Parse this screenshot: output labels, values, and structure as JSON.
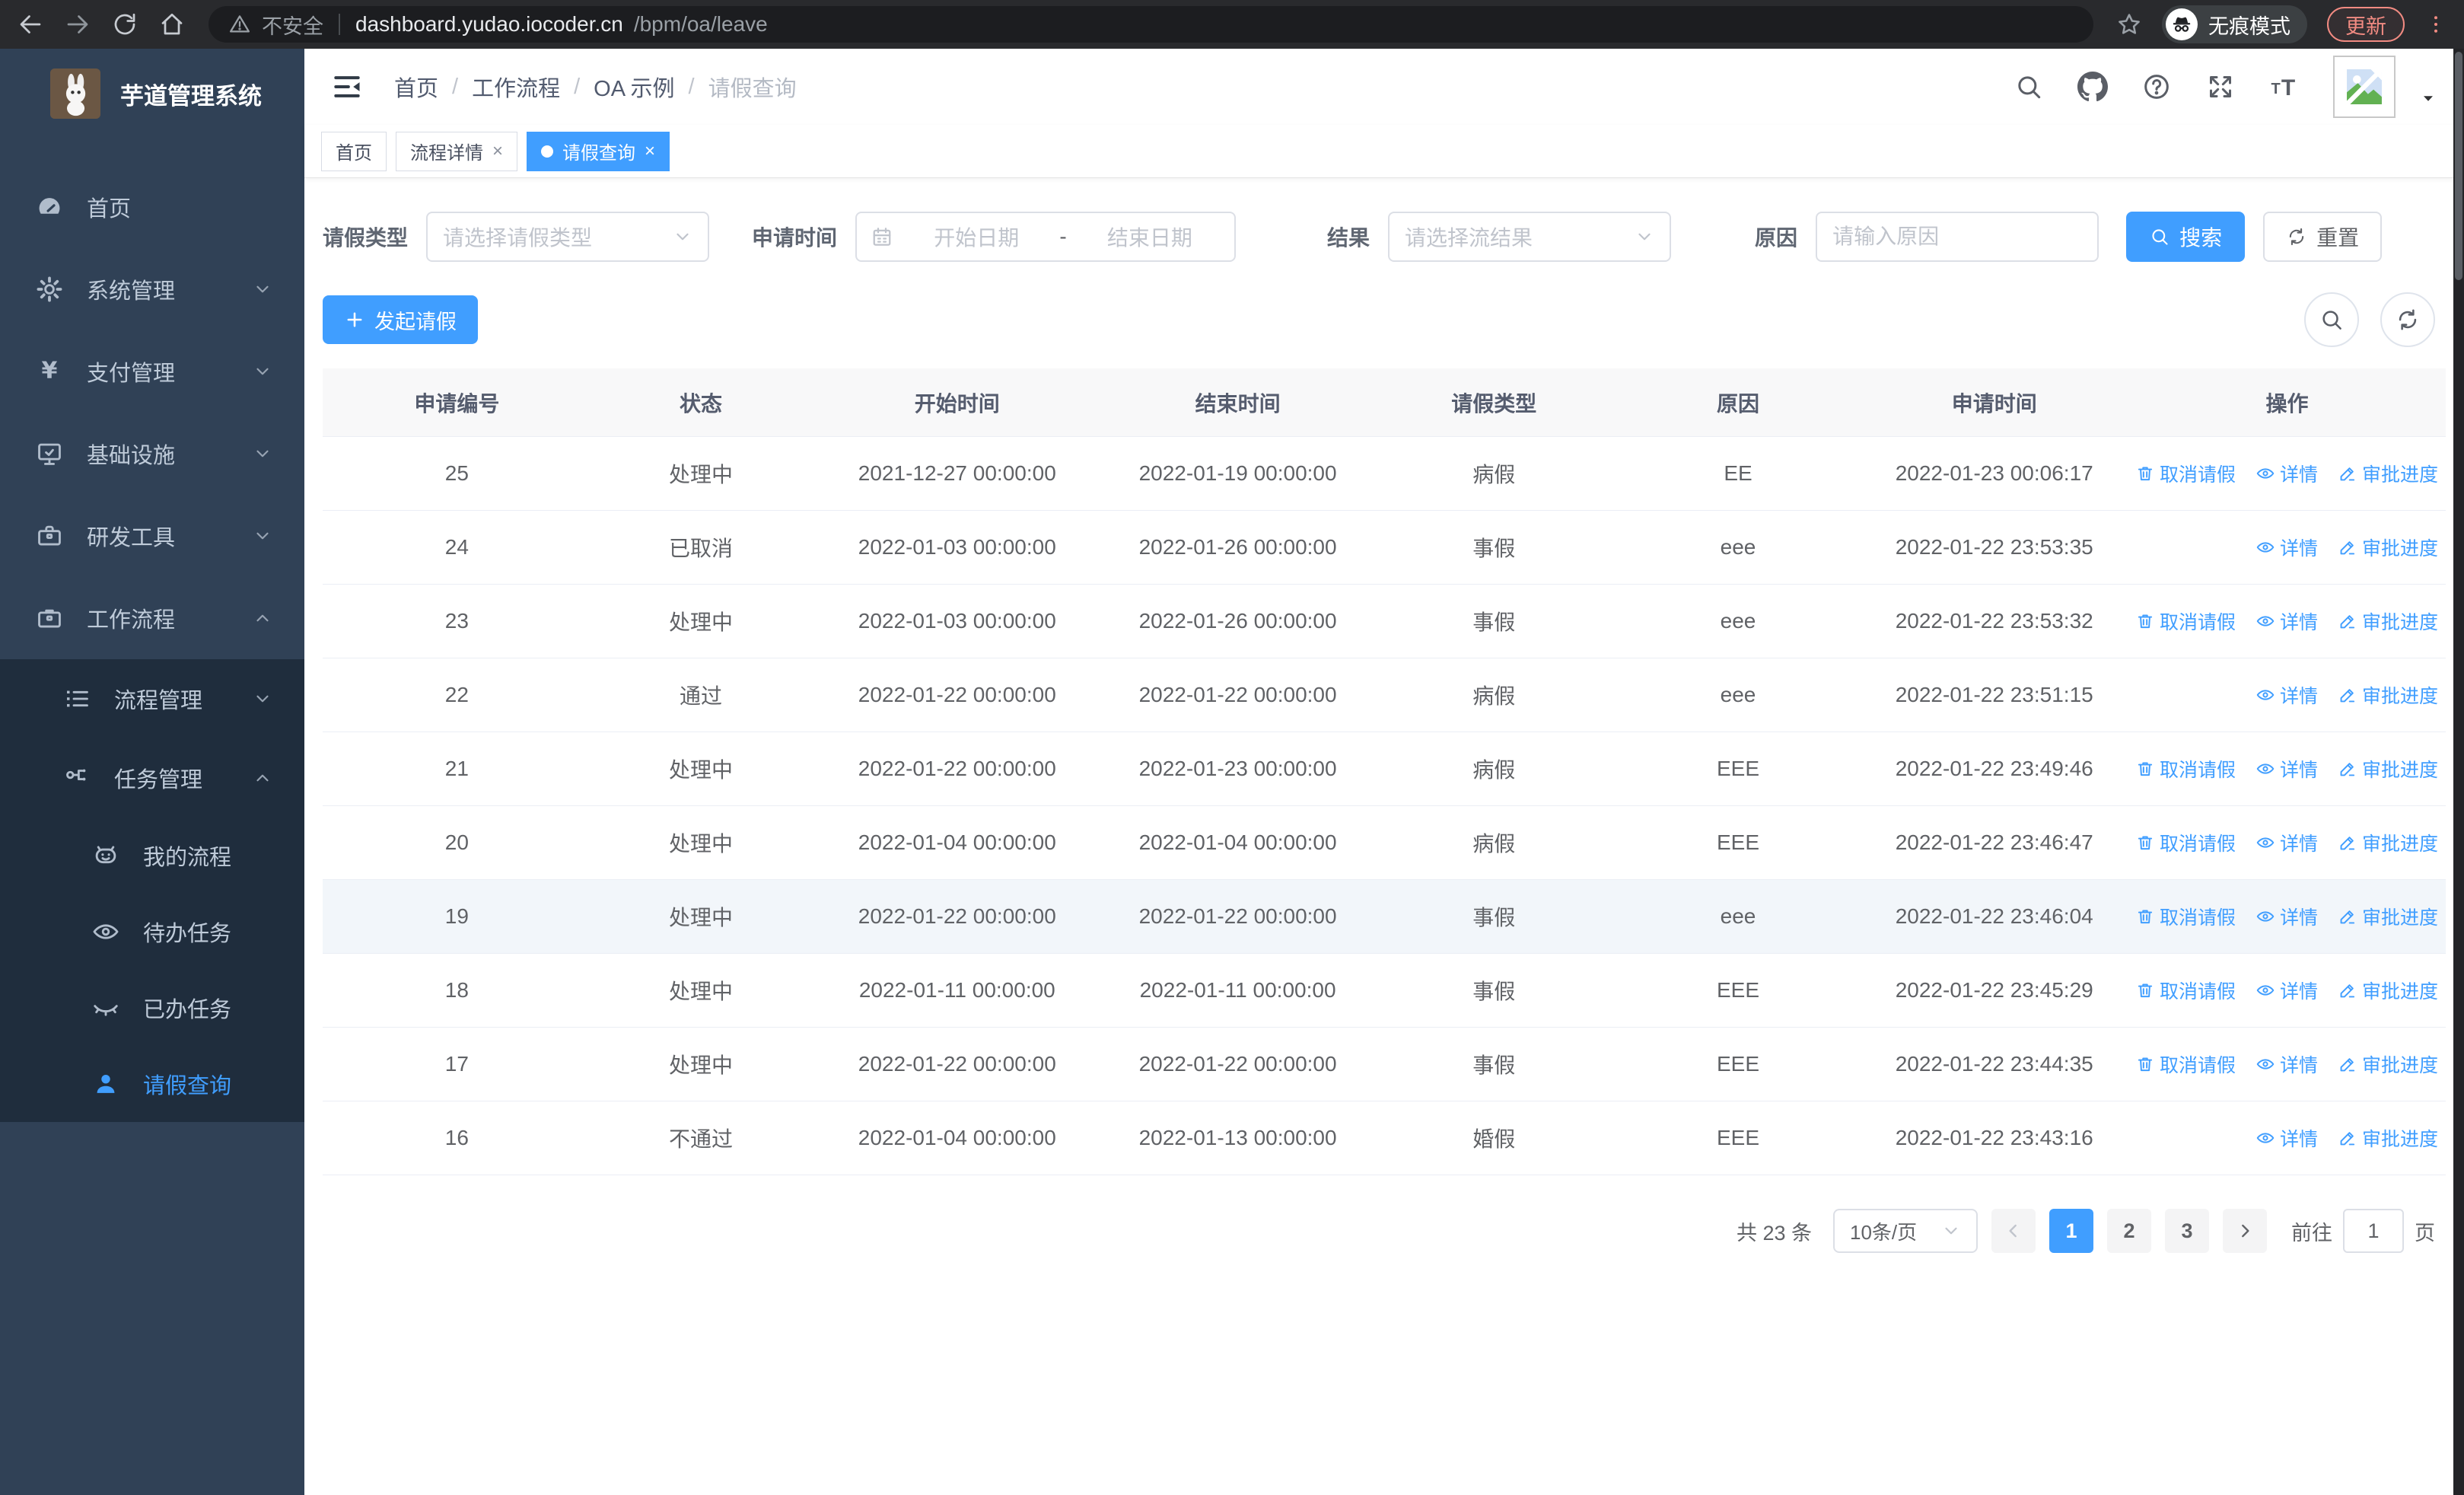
{
  "browser": {
    "security_label": "不安全",
    "url_host": "dashboard.yudao.iocoder.cn",
    "url_path": "/bpm/oa/leave",
    "incognito_label": "无痕模式",
    "update_label": "更新"
  },
  "sidebar": {
    "app_title": "芋道管理系统",
    "menu": [
      {
        "name": "home",
        "label": "首页",
        "icon": "dashboard-icon",
        "level": 1,
        "chevron": null,
        "submenu": false,
        "active": false
      },
      {
        "name": "system-management",
        "label": "系统管理",
        "icon": "gear-icon",
        "level": 1,
        "chevron": "down",
        "submenu": false,
        "active": false
      },
      {
        "name": "payment-management",
        "label": "支付管理",
        "icon": "yen-icon",
        "level": 1,
        "chevron": "down",
        "submenu": false,
        "active": false
      },
      {
        "name": "infrastructure",
        "label": "基础设施",
        "icon": "monitor-icon",
        "level": 1,
        "chevron": "down",
        "submenu": false,
        "active": false
      },
      {
        "name": "dev-tools",
        "label": "研发工具",
        "icon": "toolbox-icon",
        "level": 1,
        "chevron": "down",
        "submenu": false,
        "active": false
      },
      {
        "name": "workflow",
        "label": "工作流程",
        "icon": "briefcase-icon",
        "level": 1,
        "chevron": "up",
        "submenu": false,
        "active": false
      },
      {
        "name": "process-management",
        "label": "流程管理",
        "icon": "list-icon",
        "level": 2,
        "chevron": "down",
        "submenu": true,
        "active": false
      },
      {
        "name": "task-management",
        "label": "任务管理",
        "icon": "flow-icon",
        "level": 2,
        "chevron": "up",
        "submenu": true,
        "active": false
      },
      {
        "name": "my-process",
        "label": "我的流程",
        "icon": "robot-icon",
        "level": 3,
        "chevron": null,
        "submenu": true,
        "active": false
      },
      {
        "name": "todo-tasks",
        "label": "待办任务",
        "icon": "eye-icon",
        "level": 3,
        "chevron": null,
        "submenu": true,
        "active": false
      },
      {
        "name": "done-tasks",
        "label": "已办任务",
        "icon": "eye-closed-icon",
        "level": 3,
        "chevron": null,
        "submenu": true,
        "active": false
      },
      {
        "name": "leave-query",
        "label": "请假查询",
        "icon": "user-icon",
        "level": 3,
        "chevron": null,
        "submenu": true,
        "active": true
      }
    ]
  },
  "navbar": {
    "breadcrumb": [
      "首页",
      "工作流程",
      "OA 示例",
      "请假查询"
    ]
  },
  "tags": [
    {
      "label": "首页",
      "closable": false,
      "active": false
    },
    {
      "label": "流程详情",
      "closable": true,
      "active": false
    },
    {
      "label": "请假查询",
      "closable": true,
      "active": true
    }
  ],
  "filters": {
    "type_label": "请假类型",
    "type_placeholder": "请选择请假类型",
    "time_label": "申请时间",
    "time_start_placeholder": "开始日期",
    "time_separator": "-",
    "time_end_placeholder": "结束日期",
    "result_label": "结果",
    "result_placeholder": "请选择流结果",
    "reason_label": "原因",
    "reason_placeholder": "请输入原因",
    "search_label": "搜索",
    "reset_label": "重置"
  },
  "toolbar": {
    "create_label": "发起请假"
  },
  "table": {
    "columns": [
      "申请编号",
      "状态",
      "开始时间",
      "结束时间",
      "请假类型",
      "原因",
      "申请时间",
      "操作"
    ],
    "action_labels": {
      "cancel": "取消请假",
      "detail": "详情",
      "progress": "审批进度"
    },
    "rows": [
      {
        "id": "25",
        "status": "处理中",
        "start": "2021-12-27 00:00:00",
        "end": "2022-01-19 00:00:00",
        "type": "病假",
        "reason": "EE",
        "apply_time": "2022-01-23 00:06:17",
        "actions": [
          "cancel",
          "detail",
          "progress"
        ],
        "highlight": false
      },
      {
        "id": "24",
        "status": "已取消",
        "start": "2022-01-03 00:00:00",
        "end": "2022-01-26 00:00:00",
        "type": "事假",
        "reason": "eee",
        "apply_time": "2022-01-22 23:53:35",
        "actions": [
          "detail",
          "progress"
        ],
        "highlight": false
      },
      {
        "id": "23",
        "status": "处理中",
        "start": "2022-01-03 00:00:00",
        "end": "2022-01-26 00:00:00",
        "type": "事假",
        "reason": "eee",
        "apply_time": "2022-01-22 23:53:32",
        "actions": [
          "cancel",
          "detail",
          "progress"
        ],
        "highlight": false
      },
      {
        "id": "22",
        "status": "通过",
        "start": "2022-01-22 00:00:00",
        "end": "2022-01-22 00:00:00",
        "type": "病假",
        "reason": "eee",
        "apply_time": "2022-01-22 23:51:15",
        "actions": [
          "detail",
          "progress"
        ],
        "highlight": false
      },
      {
        "id": "21",
        "status": "处理中",
        "start": "2022-01-22 00:00:00",
        "end": "2022-01-23 00:00:00",
        "type": "病假",
        "reason": "EEE",
        "apply_time": "2022-01-22 23:49:46",
        "actions": [
          "cancel",
          "detail",
          "progress"
        ],
        "highlight": false
      },
      {
        "id": "20",
        "status": "处理中",
        "start": "2022-01-04 00:00:00",
        "end": "2022-01-04 00:00:00",
        "type": "病假",
        "reason": "EEE",
        "apply_time": "2022-01-22 23:46:47",
        "actions": [
          "cancel",
          "detail",
          "progress"
        ],
        "highlight": false
      },
      {
        "id": "19",
        "status": "处理中",
        "start": "2022-01-22 00:00:00",
        "end": "2022-01-22 00:00:00",
        "type": "事假",
        "reason": "eee",
        "apply_time": "2022-01-22 23:46:04",
        "actions": [
          "cancel",
          "detail",
          "progress"
        ],
        "highlight": true
      },
      {
        "id": "18",
        "status": "处理中",
        "start": "2022-01-11 00:00:00",
        "end": "2022-01-11 00:00:00",
        "type": "事假",
        "reason": "EEE",
        "apply_time": "2022-01-22 23:45:29",
        "actions": [
          "cancel",
          "detail",
          "progress"
        ],
        "highlight": false
      },
      {
        "id": "17",
        "status": "处理中",
        "start": "2022-01-22 00:00:00",
        "end": "2022-01-22 00:00:00",
        "type": "事假",
        "reason": "EEE",
        "apply_time": "2022-01-22 23:44:35",
        "actions": [
          "cancel",
          "detail",
          "progress"
        ],
        "highlight": false
      },
      {
        "id": "16",
        "status": "不通过",
        "start": "2022-01-04 00:00:00",
        "end": "2022-01-13 00:00:00",
        "type": "婚假",
        "reason": "EEE",
        "apply_time": "2022-01-22 23:43:16",
        "actions": [
          "detail",
          "progress"
        ],
        "highlight": false
      }
    ]
  },
  "pagination": {
    "total_label": "共 23 条",
    "page_size_label": "10条/页",
    "pages": [
      "1",
      "2",
      "3"
    ],
    "active_page": "1",
    "goto_label": "前往",
    "goto_value": "1",
    "goto_suffix": "页"
  },
  "colors": {
    "accent": "#409eff",
    "sidebar_bg": "#304156",
    "submenu_bg": "#1f2d3d",
    "chrome_update": "#f28b82"
  }
}
